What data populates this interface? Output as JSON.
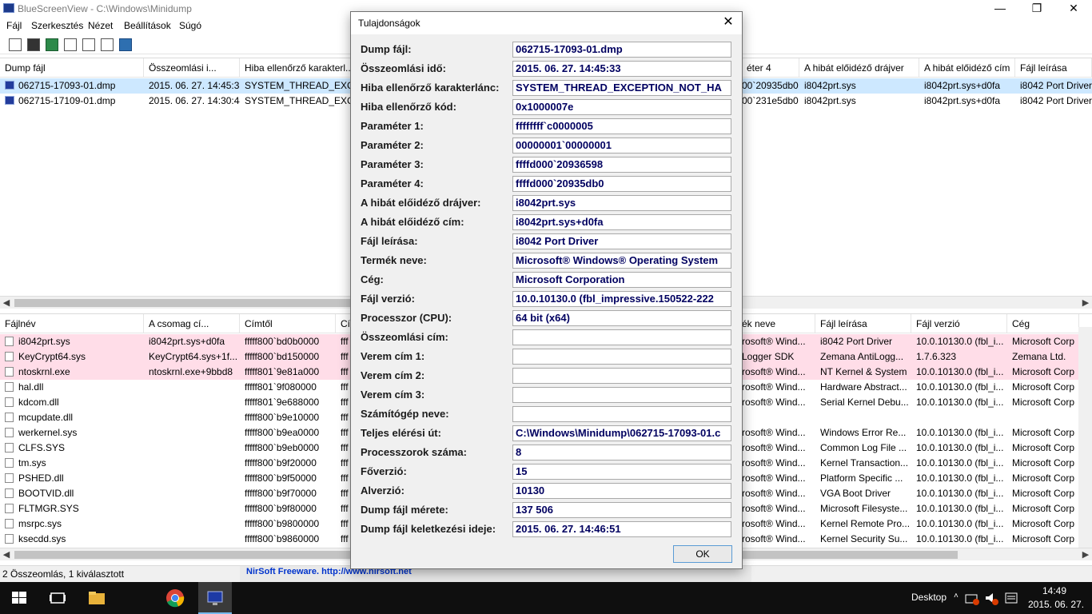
{
  "window": {
    "title": "BlueScreenView  -  C:\\Windows\\Minidump",
    "minimize": "—",
    "maximize": "❐",
    "close": "✕"
  },
  "menu": [
    "Fájl",
    "Szerkesztés",
    "Nézet",
    "Beállítások",
    "Súgó"
  ],
  "top_list": {
    "headers": [
      "Dump fájl",
      "Összeomlási i...",
      "Hiba ellenőrző karakterl...",
      "éter 4",
      "A hibát előidéző drájver",
      "A hibát előidéző cím",
      "Fájl leírása"
    ],
    "rows": [
      [
        "062715-17093-01.dmp",
        "2015. 06. 27. 14:45:33",
        "SYSTEM_THREAD_EXCE...",
        "00`20935db0",
        "i8042prt.sys",
        "i8042prt.sys+d0fa",
        "i8042 Port Driver"
      ],
      [
        "062715-17109-01.dmp",
        "2015. 06. 27. 14:30:44",
        "SYSTEM_THREAD_EXCE...",
        "00`231e5db0",
        "i8042prt.sys",
        "i8042prt.sys+d0fa",
        "i8042 Port Driver"
      ]
    ]
  },
  "bottom_list": {
    "headers": [
      "Fájlnév",
      "A csomag cí...",
      "Címtől",
      "Cí",
      "ék neve",
      "Fájl leírása",
      "Fájl verzió",
      "Cég"
    ],
    "rows": [
      [
        "i8042prt.sys",
        "i8042prt.sys+d0fa",
        "fffff800`bd0b0000",
        "fff",
        "rosoft® Wind...",
        "i8042 Port Driver",
        "10.0.10130.0 (fbl_i...",
        "Microsoft Corp"
      ],
      [
        "KeyCrypt64.sys",
        "KeyCrypt64.sys+1f...",
        "fffff800`bd150000",
        "fff",
        "Logger SDK",
        "Zemana AntiLogg...",
        "1.7.6.323",
        "Zemana Ltd."
      ],
      [
        "ntoskrnl.exe",
        "ntoskrnl.exe+9bbd8",
        "fffff801`9e81a000",
        "fff",
        "rosoft® Wind...",
        "NT Kernel & System",
        "10.0.10130.0 (fbl_i...",
        "Microsoft Corp"
      ],
      [
        "hal.dll",
        "",
        "fffff801`9f080000",
        "fff",
        "rosoft® Wind...",
        "Hardware Abstract...",
        "10.0.10130.0 (fbl_i...",
        "Microsoft Corp"
      ],
      [
        "kdcom.dll",
        "",
        "fffff801`9e688000",
        "fff",
        "rosoft® Wind...",
        "Serial Kernel Debu...",
        "10.0.10130.0 (fbl_i...",
        "Microsoft Corp"
      ],
      [
        "mcupdate.dll",
        "",
        "fffff800`b9e10000",
        "fff",
        "",
        "",
        "",
        ""
      ],
      [
        "werkernel.sys",
        "",
        "fffff800`b9ea0000",
        "fff",
        "rosoft® Wind...",
        "Windows Error Re...",
        "10.0.10130.0 (fbl_i...",
        "Microsoft Corp"
      ],
      [
        "CLFS.SYS",
        "",
        "fffff800`b9eb0000",
        "fff",
        "rosoft® Wind...",
        "Common Log File ...",
        "10.0.10130.0 (fbl_i...",
        "Microsoft Corp"
      ],
      [
        "tm.sys",
        "",
        "fffff800`b9f20000",
        "fff",
        "rosoft® Wind...",
        "Kernel Transaction...",
        "10.0.10130.0 (fbl_i...",
        "Microsoft Corp"
      ],
      [
        "PSHED.dll",
        "",
        "fffff800`b9f50000",
        "fff",
        "rosoft® Wind...",
        "Platform Specific ...",
        "10.0.10130.0 (fbl_i...",
        "Microsoft Corp"
      ],
      [
        "BOOTVID.dll",
        "",
        "fffff800`b9f70000",
        "fff",
        "rosoft® Wind...",
        "VGA Boot Driver",
        "10.0.10130.0 (fbl_i...",
        "Microsoft Corp"
      ],
      [
        "FLTMGR.SYS",
        "",
        "fffff800`b9f80000",
        "fff",
        "rosoft® Wind...",
        "Microsoft Filesyste...",
        "10.0.10130.0 (fbl_i...",
        "Microsoft Corp"
      ],
      [
        "msrpc.sys",
        "",
        "fffff800`b9800000",
        "fff",
        "rosoft® Wind...",
        "Kernel Remote Pro...",
        "10.0.10130.0 (fbl_i...",
        "Microsoft Corp"
      ],
      [
        "ksecdd.sys",
        "",
        "fffff800`b9860000",
        "fff",
        "rosoft® Wind...",
        "Kernel Security Su...",
        "10.0.10130.0 (fbl_i...",
        "Microsoft Corp"
      ]
    ]
  },
  "status": {
    "text": "2 Összeomlás, 1 kiválasztott",
    "nirsoft": "NirSoft Freeware.  http://www.nirsoft.net"
  },
  "dialog": {
    "title": "Tulajdonságok",
    "close": "✕",
    "ok": "OK",
    "properties": [
      {
        "label": "Dump fájl:",
        "value": "062715-17093-01.dmp"
      },
      {
        "label": "Összeomlási idő:",
        "value": "2015. 06. 27. 14:45:33"
      },
      {
        "label": "Hiba ellenőrző karakterlánc:",
        "value": "SYSTEM_THREAD_EXCEPTION_NOT_HA"
      },
      {
        "label": "Hiba ellenőrző kód:",
        "value": "0x1000007e"
      },
      {
        "label": "Paraméter 1:",
        "value": "ffffffff`c0000005"
      },
      {
        "label": "Paraméter 2:",
        "value": "00000001`00000001"
      },
      {
        "label": "Paraméter 3:",
        "value": "ffffd000`20936598"
      },
      {
        "label": "Paraméter 4:",
        "value": "ffffd000`20935db0"
      },
      {
        "label": "A hibát előidéző drájver:",
        "value": "i8042prt.sys"
      },
      {
        "label": "A hibát előidéző cím:",
        "value": "i8042prt.sys+d0fa"
      },
      {
        "label": "Fájl leírása:",
        "value": "i8042 Port Driver"
      },
      {
        "label": "Termék neve:",
        "value": "Microsoft® Windows® Operating System"
      },
      {
        "label": "Cég:",
        "value": "Microsoft Corporation"
      },
      {
        "label": "Fájl verzió:",
        "value": "10.0.10130.0 (fbl_impressive.150522-222"
      },
      {
        "label": "Processzor (CPU):",
        "value": "64 bit (x64)"
      },
      {
        "label": "Összeomlási cím:",
        "value": ""
      },
      {
        "label": "Verem cím 1:",
        "value": ""
      },
      {
        "label": "Verem cím 2:",
        "value": ""
      },
      {
        "label": "Verem cím 3:",
        "value": ""
      },
      {
        "label": "Számítógép neve:",
        "value": ""
      },
      {
        "label": "Teljes elérési út:",
        "value": "C:\\Windows\\Minidump\\062715-17093-01.c"
      },
      {
        "label": "Processzorok száma:",
        "value": "8"
      },
      {
        "label": "Főverzió:",
        "value": "15"
      },
      {
        "label": "Alverzió:",
        "value": "10130"
      },
      {
        "label": "Dump fájl mérete:",
        "value": "137 506"
      },
      {
        "label": "Dump fájl keletkezési ideje:",
        "value": "2015. 06. 27. 14:46:51"
      }
    ]
  },
  "taskbar": {
    "desktop": "Desktop",
    "time": "14:49",
    "date": "2015. 06. 27."
  }
}
